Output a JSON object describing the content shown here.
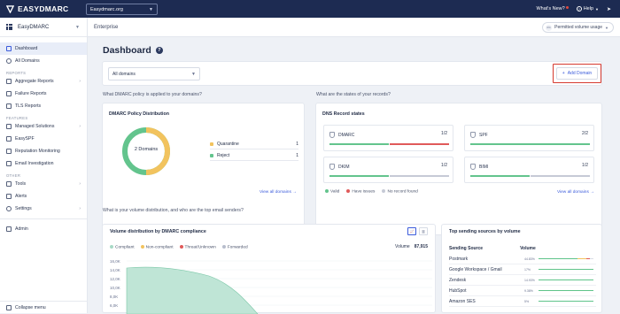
{
  "topbar": {
    "brand": "EASYDMARC",
    "org_select": "Easydmarc.org",
    "whats_new": "What's New?",
    "help": "Help"
  },
  "sidebar": {
    "org_name": "EasyDMARC",
    "items_top": [
      {
        "label": "Dashboard",
        "active": true
      },
      {
        "label": "All Domains",
        "active": false
      }
    ],
    "reports_label": "REPORTS",
    "reports": [
      {
        "label": "Aggregate Reports",
        "arrow": true
      },
      {
        "label": "Failure Reports",
        "arrow": false
      },
      {
        "label": "TLS Reports",
        "arrow": false
      }
    ],
    "features_label": "FEATURES",
    "features": [
      {
        "label": "Managed Solutions",
        "arrow": true
      },
      {
        "label": "EasySPF",
        "arrow": false
      },
      {
        "label": "Reputation Monitoring",
        "arrow": false
      },
      {
        "label": "Email Investigation",
        "arrow": false
      }
    ],
    "other_label": "OTHER",
    "other": [
      {
        "label": "Tools",
        "arrow": true
      },
      {
        "label": "Alerts",
        "arrow": false
      },
      {
        "label": "Settings",
        "arrow": true
      }
    ],
    "admin": "Admin",
    "collapse": "Collapse menu"
  },
  "subheader": {
    "title": "Enterprise",
    "usage_pct": "0%",
    "usage_label": "Permitted volume usage"
  },
  "dashboard": {
    "title": "Dashboard",
    "filter_placeholder": "All domains",
    "add_domain": "Add Domain",
    "q_policy": "What DMARC policy is applied to your domains?",
    "q_records": "What are the states of your records?",
    "q_volume": "What is your volume distribution, and who are the top email senders?"
  },
  "policy": {
    "title": "DMARC Policy Distribution",
    "center": "2 Domains",
    "legend": [
      {
        "label": "Quarantine",
        "count": "1",
        "color": "#f2c35e"
      },
      {
        "label": "Reject",
        "count": "1",
        "color": "#63c48d"
      }
    ],
    "view_all": "View all domains →"
  },
  "dns": {
    "title": "DNS Record states",
    "records": [
      {
        "name": "DMARC",
        "ratio": "1/2",
        "valid": 0.5,
        "issues": 0.5,
        "none": 0
      },
      {
        "name": "SPF",
        "ratio": "2/2",
        "valid": 1,
        "issues": 0,
        "none": 0
      },
      {
        "name": "DKIM",
        "ratio": "1/2",
        "valid": 0.5,
        "issues": 0,
        "none": 0.5
      },
      {
        "name": "BIMI",
        "ratio": "1/2",
        "valid": 0.5,
        "issues": 0,
        "none": 0.5
      }
    ],
    "legend": [
      {
        "label": "Valid",
        "color": "#63c48d"
      },
      {
        "label": "Have issues",
        "color": "#e05a5a"
      },
      {
        "label": "No record found",
        "color": "#c6cad6"
      }
    ],
    "view_all": "View all domains →"
  },
  "volume": {
    "title": "Volume distribution by DMARC compliance",
    "legend": [
      {
        "label": "Compliant",
        "color": "#a8d9c6"
      },
      {
        "label": "Non-compliant",
        "color": "#f2c35e"
      },
      {
        "label": "Threat/Unknown",
        "color": "#e05a5a"
      },
      {
        "label": "Forwarded",
        "color": "#b7bdcc"
      }
    ],
    "total_label": "Volume",
    "total_value": "87,915",
    "y_ticks": [
      "16,0K",
      "14,0K",
      "12,0K",
      "10,0K",
      "8,0K",
      "6,0K"
    ]
  },
  "top_sources": {
    "title": "Top sending sources by volume",
    "col_source": "Sending Source",
    "col_volume": "Volume",
    "rows": [
      {
        "name": "Postmark",
        "pct": "44.83%",
        "fill": 0.7,
        "colors": true
      },
      {
        "name": "Google Workspace / Gmail",
        "pct": "17%",
        "fill": 1,
        "colors": false
      },
      {
        "name": "Zendesk",
        "pct": "14.93%",
        "fill": 1,
        "colors": false
      },
      {
        "name": "HubSpot",
        "pct": "9.38%",
        "fill": 1,
        "colors": false
      },
      {
        "name": "Amazon SES",
        "pct": "5%",
        "fill": 1,
        "colors": false
      }
    ]
  }
}
